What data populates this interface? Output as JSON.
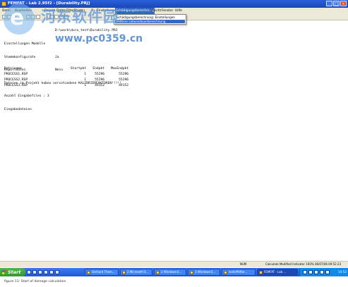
{
  "window": {
    "title": "FEMFAT - Lab 2.95f2 - [Durability.PRJ]",
    "controls": [
      "_",
      "□",
      "×"
    ]
  },
  "menubar": {
    "items": [
      "Datei",
      "Bearbeiten",
      "Projekt",
      "Daten",
      "Filter",
      "Fragen",
      "?",
      "Einstellungen",
      "Schädigungsberechnung",
      "Ansicht",
      "Fenster",
      "Hilfe"
    ],
    "active_index": 8
  },
  "dropdown": {
    "items": [
      "Schädigungsberechnung: Einstellungen",
      "Mittlere Lebensdauerberechnung"
    ],
    "selected_index": 1
  },
  "document": {
    "path_line": "D:\\work\\dura_test\\Durability.PRJ",
    "lines": [
      {
        "label": "Einstellungen Modelle",
        "value": ""
      },
      {
        "label": "Stemmkonfigurate",
        "value": "Ja"
      },
      {
        "label": "Reportdatei",
        "value": "Nein"
      },
      {
        "label": "Dateien im Projekt haben verschiedene KALIBRIERFAKTOREN!!!!!",
        "value": ""
      },
      {
        "label": "Anzahl Eingabefiles : 3",
        "value": ""
      },
      {
        "label": "Eingabedateien",
        "value": ""
      }
    ],
    "table": {
      "headers": [
        "Dateiname",
        "Startpkt",
        "Endpkt",
        "MaxEndpkt"
      ],
      "rows": [
        [
          "PROCESS1.RSP",
          "1",
          "55296",
          "55296"
        ],
        [
          "PROCESS2.RSP",
          "1",
          "55296",
          "55296"
        ],
        [
          "PROCESS3.RSP",
          "1",
          "49152",
          "49152"
        ]
      ]
    }
  },
  "statusbar": {
    "num": "NUM",
    "info": "Calculate  Modified  Indicator  100%  06/07/06  09:52:23"
  },
  "taskbar": {
    "start_label": "Start",
    "tasks": [
      "Gerhard Thom...",
      "2 Microsoft O...",
      "2 Windows-E...",
      "3 Windows-E...",
      "eceleffefbe...",
      "FEMFAT - Lab ..."
    ],
    "active_task_index": 5,
    "clock": "10:52"
  },
  "caption": "figure 11: Start of damage calculation",
  "watermark": {
    "title": "河东软件园",
    "url": "www.pc0359.cn"
  },
  "colors": {
    "titlebar": "#2b5fd8",
    "menu_highlight": "#316ac5",
    "taskbar": "#2258d4",
    "start_button": "#2f9a2c"
  }
}
